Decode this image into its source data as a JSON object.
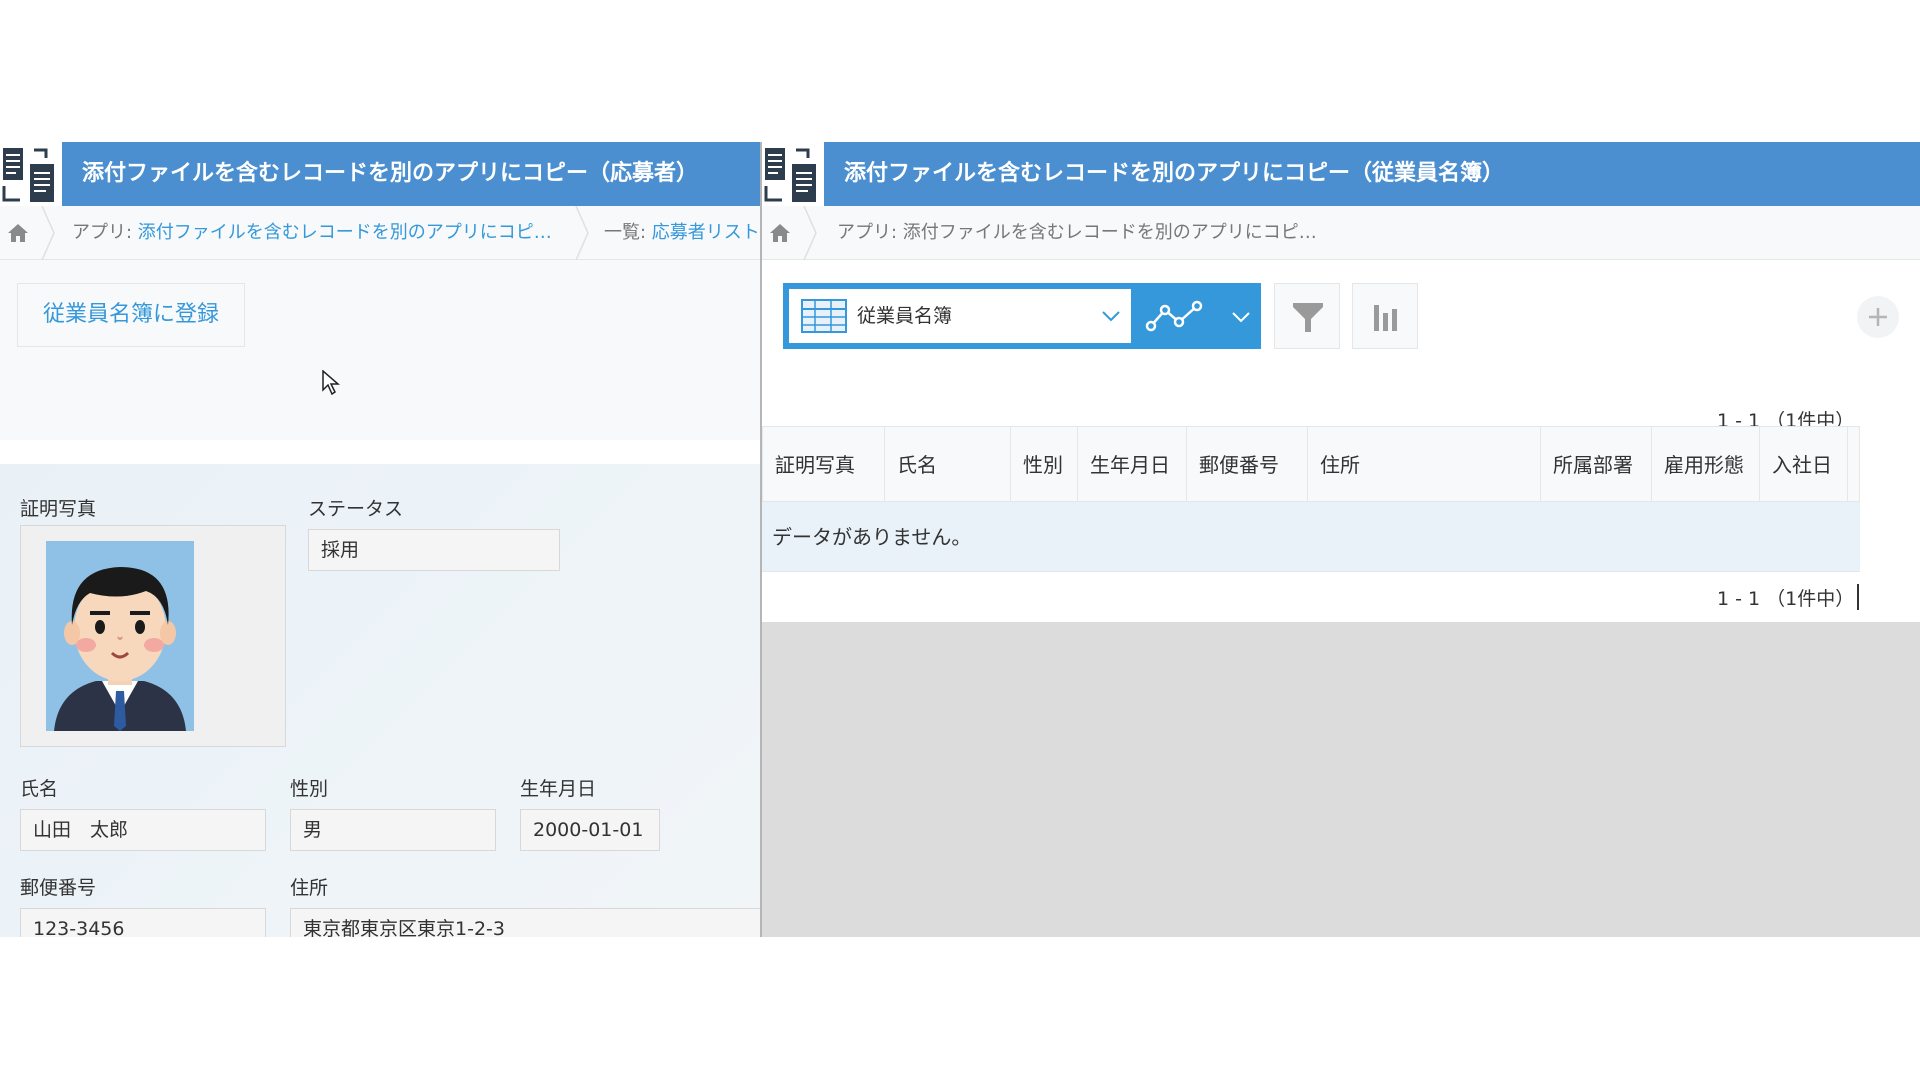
{
  "left": {
    "app_title": "添付ファイルを含むレコードを別のアプリにコピー（応募者）",
    "breadcrumb": {
      "app_prefix": "アプリ: ",
      "app_link": "添付ファイルを含むレコードを別のアプリにコピ…",
      "list_prefix": "一覧: ",
      "list_link": "応募者リスト"
    },
    "register_button": "従業員名簿に登録",
    "fields": {
      "photo_label": "証明写真",
      "status_label": "ステータス",
      "status_value": "採用",
      "name_label": "氏名",
      "name_value": "山田　太郎",
      "gender_label": "性別",
      "gender_value": "男",
      "birthday_label": "生年月日",
      "birthday_value": "2000-01-01",
      "zip_label": "郵便番号",
      "zip_value": "123-3456",
      "address_label": "住所",
      "address_value": "東京都東京区東京1-2-3"
    }
  },
  "right": {
    "app_title": "添付ファイルを含むレコードを別のアプリにコピー（従業員名簿）",
    "breadcrumb": {
      "app_prefix": "アプリ: ",
      "app_name": "添付ファイルを含むレコードを別のアプリにコピ…"
    },
    "view_name": "従業員名簿",
    "pager_top": "1 - 1 （1件中）",
    "pager_bottom": "1 - 1 （1件中）",
    "columns": [
      "証明写真",
      "氏名",
      "性別",
      "生年月日",
      "郵便番号",
      "住所",
      "所属部署",
      "雇用形態",
      "入社日"
    ],
    "empty_message": "データがありません。"
  },
  "colors": {
    "header_blue": "#4b8fd0",
    "link_blue": "#3498db",
    "gray_area": "#dcdcdc"
  }
}
